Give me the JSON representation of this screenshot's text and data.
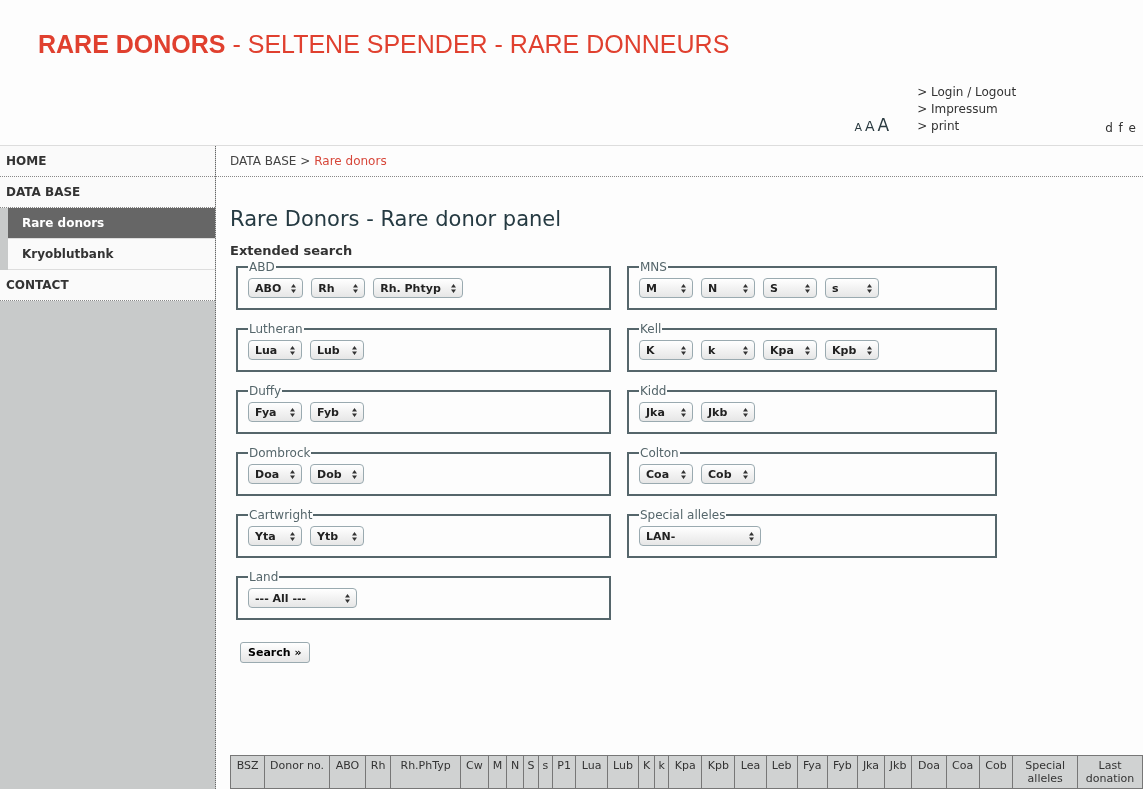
{
  "site_title": {
    "main": "RARE DONORS",
    "rest": " - SELTENE SPENDER - RARE DONNEURS"
  },
  "font_sizes": [
    "A",
    "A",
    "A"
  ],
  "top_links": [
    "> Login / Logout",
    "> Impressum",
    "> print"
  ],
  "languages": "d f e",
  "breadcrumb": {
    "parent": "DATA BASE >",
    "current": "Rare donors"
  },
  "sidebar": {
    "items": [
      {
        "label": "HOME",
        "selected": false
      },
      {
        "label": "DATA BASE",
        "selected": false,
        "children": [
          {
            "label": "Rare donors",
            "selected": true
          },
          {
            "label": "Kryoblutbank",
            "selected": false
          }
        ]
      },
      {
        "label": "CONTACT",
        "selected": false
      }
    ]
  },
  "page_title": "Rare Donors - Rare donor panel",
  "section_title": "Extended search",
  "groups": [
    {
      "legend": "ABD",
      "selects": [
        "ABO",
        "Rh",
        "Rh. Phtyp"
      ]
    },
    {
      "legend": "MNS",
      "selects": [
        "M",
        "N",
        "S",
        "s"
      ]
    },
    {
      "legend": "Lutheran",
      "selects": [
        "Lua",
        "Lub"
      ]
    },
    {
      "legend": "Kell",
      "selects": [
        "K",
        "k",
        "Kpa",
        "Kpb"
      ]
    },
    {
      "legend": "Duffy",
      "selects": [
        "Fya",
        "Fyb"
      ]
    },
    {
      "legend": "Kidd",
      "selects": [
        "Jka",
        "Jkb"
      ]
    },
    {
      "legend": "Dombrock",
      "selects": [
        "Doa",
        "Dob"
      ]
    },
    {
      "legend": "Colton",
      "selects": [
        "Coa",
        "Cob"
      ]
    },
    {
      "legend": "Cartwright",
      "selects": [
        "Yta",
        "Ytb"
      ]
    },
    {
      "legend": "Special alleles",
      "selects": [
        "LAN-"
      ]
    },
    {
      "legend": "Land",
      "selects": [
        "--- All ---"
      ]
    }
  ],
  "search_button": "Search »",
  "table": {
    "columns": [
      "BSZ",
      "Donor no.",
      "ABO",
      "Rh",
      "Rh.PhTyp",
      "Cw",
      "M",
      "N",
      "S",
      "s",
      "P1",
      "Lua",
      "Lub",
      "K",
      "k",
      "Kpa",
      "Kpb",
      "Lea",
      "Leb",
      "Fya",
      "Fyb",
      "Jka",
      "Jkb",
      "Doa",
      "Coa",
      "Cob",
      "Special alleles",
      "Last donation"
    ]
  }
}
